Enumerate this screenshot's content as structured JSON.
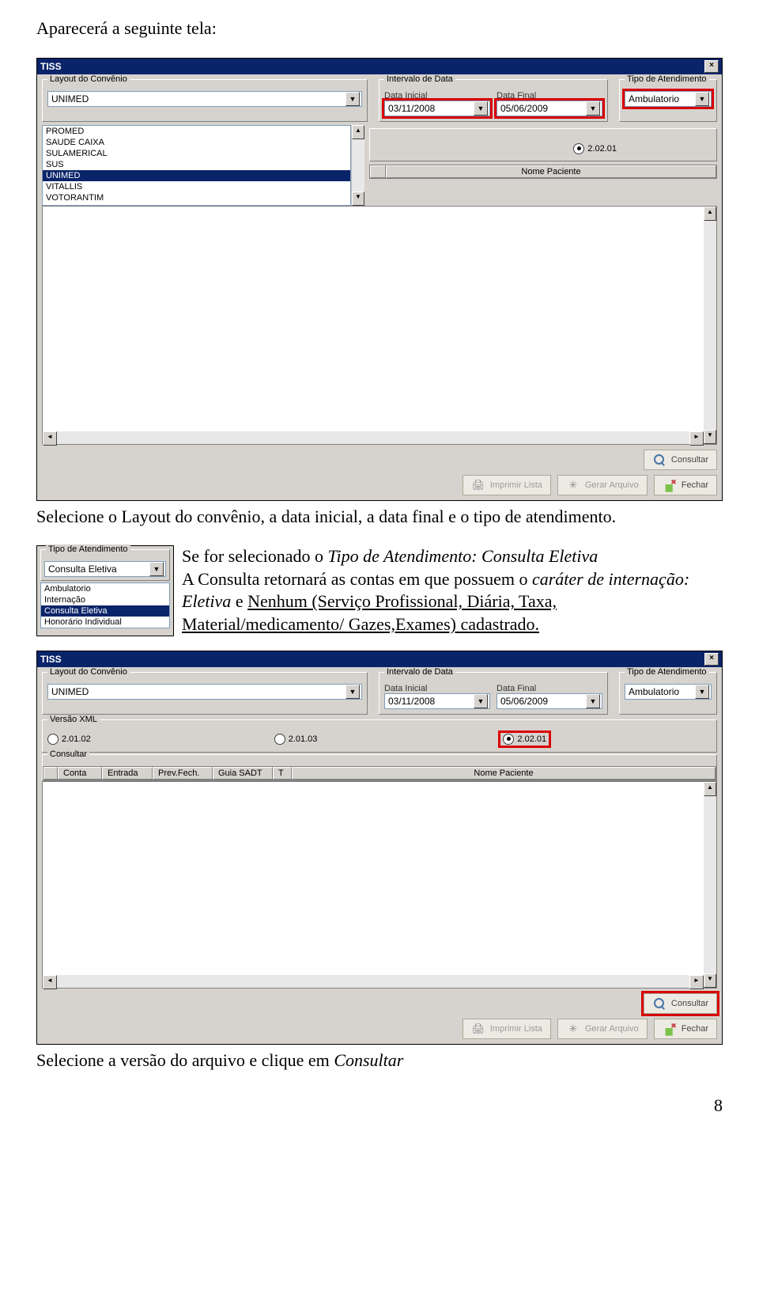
{
  "doc": {
    "intro": "Aparecerá a seguinte tela:",
    "p1": "Selecione o Layout do convênio, a data inicial, a data final e o tipo de atendimento.",
    "p2a": "Se for selecionado o ",
    "p2b": "Tipo de Atendimento: Consulta Eletiva",
    "p3a": "A Consulta retornará as contas em que possuem o ",
    "p3b": "caráter de internação: Eletiva",
    "p3c": " e ",
    "p3d": "Nenhum (Serviço Profissional, Diária, Taxa, Material/medicamento/ Gazes,Exames) cadastrado.",
    "p_last": "Selecione a versão do arquivo e clique em ",
    "p_last_i": "Consultar",
    "page_num": "8"
  },
  "win": {
    "title": "TISS",
    "group_layout": "Layout do Convênio",
    "group_intervalo": "Intervalo de Data",
    "lbl_data_inicial": "Data Inicial",
    "lbl_data_final": "Data Final",
    "group_tipo": "Tipo de Atendimento",
    "group_versao": "Versão XML",
    "group_consultar": "Consultar",
    "layout_value": "UNIMED",
    "data_inicial": "03/11/2008",
    "data_final": "05/06/2009",
    "tipo_value": "Ambulatorio",
    "versao_opts": [
      "2.01.02",
      "2.01.03",
      "2.02.01"
    ],
    "layout_list": [
      "PROMED",
      "SAUDE CAIXA",
      "SULAMERICAL",
      "SUS",
      "UNIMED",
      "VITALLIS",
      "VOTORANTIM"
    ],
    "col_nome_paciente": "Nome Paciente",
    "cols": [
      "Conta",
      "Entrada",
      "Prev.Fech.",
      "Guia SADT",
      "T"
    ],
    "btn_consultar": "Consultar",
    "btn_imprimir": "Imprimir Lista",
    "btn_gerar": "Gerar Arquivo",
    "btn_fechar": "Fechar"
  },
  "small": {
    "group": "Tipo de Atendimento",
    "value": "Consulta Eletiva",
    "list": [
      "Ambulatorio",
      "Internação",
      "Consulta Eletiva",
      "Honorário Individual"
    ]
  }
}
